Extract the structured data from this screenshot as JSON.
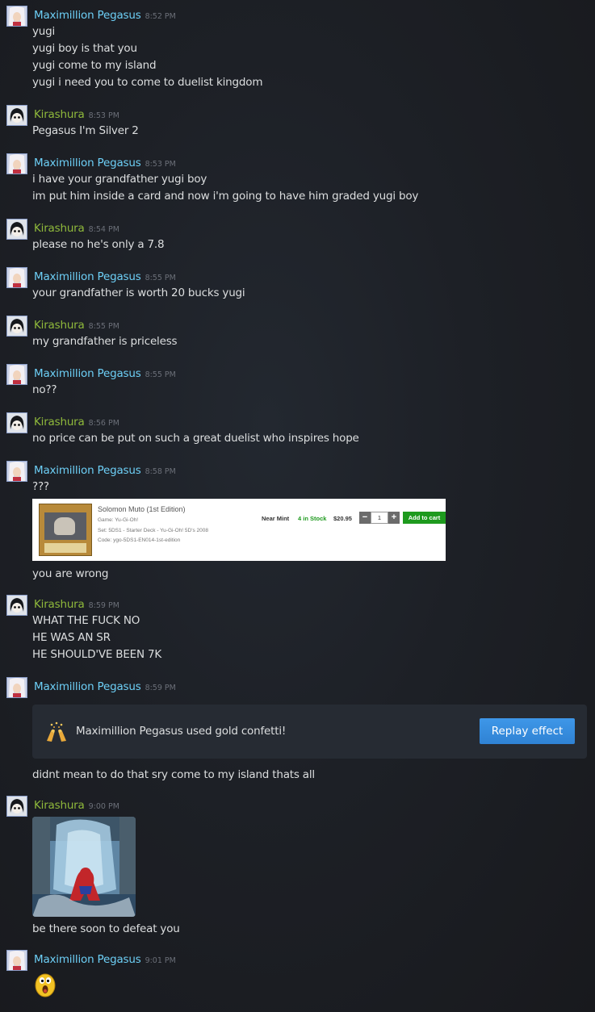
{
  "colors": {
    "pegasus": "#6dcff6",
    "kirashura": "#8fb93b",
    "replay_button": "#3e97e8",
    "in_stock": "#1e9a1e"
  },
  "messages": [
    {
      "author": "Maximillion Pegasus",
      "time": "8:52 PM",
      "lines": [
        "yugi",
        "yugi boy is that you",
        "yugi come to my island",
        "yugi i need you to come to duelist kingdom"
      ]
    },
    {
      "author": "Kirashura",
      "time": "8:53 PM",
      "lines": [
        "Pegasus I'm Silver 2"
      ]
    },
    {
      "author": "Maximillion Pegasus",
      "time": "8:53 PM",
      "lines": [
        "i have your grandfather yugi boy",
        "im put him inside a card and now i'm going to have him graded yugi boy"
      ]
    },
    {
      "author": "Kirashura",
      "time": "8:54 PM",
      "lines": [
        "please no he's only a 7.8"
      ]
    },
    {
      "author": "Maximillion Pegasus",
      "time": "8:55 PM",
      "lines": [
        "your grandfather is worth 20 bucks yugi"
      ]
    },
    {
      "author": "Kirashura",
      "time": "8:55 PM",
      "lines": [
        "my grandfather is priceless"
      ]
    },
    {
      "author": "Maximillion Pegasus",
      "time": "8:55 PM",
      "lines": [
        "no??"
      ]
    },
    {
      "author": "Kirashura",
      "time": "8:56 PM",
      "lines": [
        "no price can be put on such a great duelist who inspires hope"
      ]
    },
    {
      "author": "Maximillion Pegasus",
      "time": "8:58 PM",
      "lines": [
        "???"
      ],
      "after_card_lines": [
        "you are wrong"
      ]
    },
    {
      "author": "Kirashura",
      "time": "8:59 PM",
      "lines": [
        "WHAT THE FUCK NO",
        "HE WAS AN SR",
        "HE SHOULD'VE BEEN 7K"
      ]
    },
    {
      "author": "Maximillion Pegasus",
      "time": "8:59 PM",
      "lines": [],
      "after_effect_lines": [
        "didnt mean to do that sry come to my island thats all"
      ]
    },
    {
      "author": "Kirashura",
      "time": "9:00 PM",
      "lines": [],
      "after_image_lines": [
        "be there soon to defeat you"
      ]
    },
    {
      "author": "Maximillion Pegasus",
      "time": "9:01 PM",
      "lines": [],
      "emoji": "surprised-face-emoticon"
    }
  ],
  "product_card": {
    "title": "Solomon Muto (1st Edition)",
    "game": "Game: Yu-Gi-Oh!",
    "set": "Set: 5DS1 - Starter Deck - Yu-Gi-Oh! 5D's 2008",
    "code": "Code: ygo-5DS1-EN014-1st-edition",
    "condition": "Near Mint",
    "stock": "4 in Stock",
    "price": "$20.95",
    "quantity": "1",
    "minus": "−",
    "plus": "+",
    "add_to_cart": "Add to cart"
  },
  "effect": {
    "icon": "gold-confetti-hands-icon",
    "text": "Maximillion Pegasus used gold confetti!",
    "button": "Replay effect"
  },
  "image_attachment": {
    "subject": "spider-man-in-water"
  }
}
